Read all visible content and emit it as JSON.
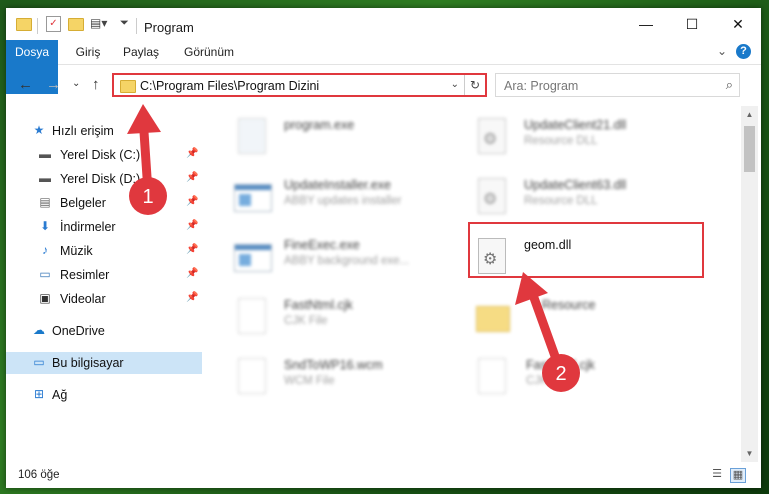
{
  "window": {
    "title": "Program",
    "controls": {
      "minimize": "—",
      "maximize": "☐",
      "close": "✕"
    }
  },
  "ribbon": {
    "tabs": [
      "Dosya",
      "Giriş",
      "Paylaş",
      "Görünüm"
    ],
    "help": "?",
    "expand": "⌄"
  },
  "navbar": {
    "back": "←",
    "forward": "→",
    "recent": "⌄",
    "up": "↑",
    "address": "C:\\Program Files\\Program Dizini",
    "search_placeholder": "Ara: Program"
  },
  "sidebar": {
    "quick_access": "Hızlı erişim",
    "items": [
      {
        "label": "Yerel Disk (C:)",
        "icon": "drive-icon"
      },
      {
        "label": "Yerel Disk (D:)",
        "icon": "drive-icon"
      },
      {
        "label": "Belgeler",
        "icon": "documents-icon"
      },
      {
        "label": "İndirmeler",
        "icon": "downloads-icon"
      },
      {
        "label": "Müzik",
        "icon": "music-icon"
      },
      {
        "label": "Resimler",
        "icon": "pictures-icon"
      },
      {
        "label": "Videolar",
        "icon": "videos-icon"
      }
    ],
    "onedrive": "OneDrive",
    "this_pc": "Bu bilgisayar",
    "network": "Ağ"
  },
  "files": [
    {
      "name": "program.exe",
      "type": "",
      "icon": "program-exe-icon"
    },
    {
      "name": "UpdateClient21.dll",
      "type": "Resource DLL",
      "icon": "dll-icon"
    },
    {
      "name": "UpdateInstaller.exe",
      "type": "ABBY updates installer",
      "icon": "exe-icon"
    },
    {
      "name": "UpdateClient63.dll",
      "type": "Resource DLL",
      "icon": "dll-icon"
    },
    {
      "name": "FineExec.exe",
      "type": "ABBY background exe...",
      "icon": "exe-icon"
    },
    {
      "name": "geom.dll",
      "type": "",
      "icon": "dll-icon"
    },
    {
      "name": "FastNtml.cjk",
      "type": "CJK File",
      "icon": "file-icon"
    },
    {
      "name": "Resource",
      "type": "",
      "icon": "folder-icon"
    },
    {
      "name": "SndToWP16.wcm",
      "type": "WCM File",
      "icon": "file-icon"
    },
    {
      "name": "FastNtml.cjk",
      "type": "CJK File",
      "icon": "file-icon"
    }
  ],
  "status": {
    "item_count": "106 öğe"
  },
  "annotations": {
    "step1": "1",
    "step2": "2"
  },
  "colors": {
    "accent": "#1979ca",
    "highlight": "#e0383e",
    "selected": "#cce4f7"
  }
}
